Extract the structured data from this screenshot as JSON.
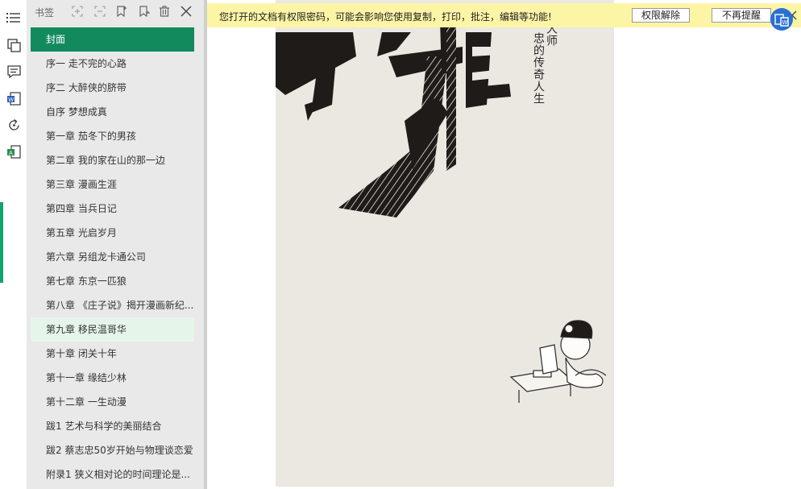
{
  "sidebar_panel": {
    "title": "书签",
    "bookmarks": [
      {
        "label": "封面"
      },
      {
        "label": "序一 走不完的心路"
      },
      {
        "label": "序二 大醉侠的脐带"
      },
      {
        "label": "自序 梦想成真"
      },
      {
        "label": "第一章 茄冬下的男孩"
      },
      {
        "label": "第二章 我的家在山的那一边"
      },
      {
        "label": "第三章 漫画生涯"
      },
      {
        "label": "第四章 当兵日记"
      },
      {
        "label": "第五章 光启岁月"
      },
      {
        "label": "第六章 另组龙卡通公司"
      },
      {
        "label": "第七章 东京一匹狼"
      },
      {
        "label": "第八章 《庄子说》揭开漫画新纪..."
      },
      {
        "label": "第九章 移民温哥华"
      },
      {
        "label": "第十章 闭关十年"
      },
      {
        "label": "第十一章 缘结少林"
      },
      {
        "label": "第十二章 一生动漫"
      },
      {
        "label": "跋1 艺术与科学的美丽结合"
      },
      {
        "label": "跋2 蔡志忠50岁开始与物理谈恋爱"
      },
      {
        "label": "附录1 狭义相对论的时间理论是..."
      }
    ],
    "active_index": 0,
    "hover_index": 12
  },
  "notice": {
    "text": "您打开的文档有权限密码，可能会影响您使用复制，打印，批注，编辑等功能!",
    "unlock_button": "权限解除",
    "dismiss_button": "不再提醒"
  },
  "cover": {
    "side_text_1": "大师",
    "side_text_2": "忠的传奇人生"
  },
  "colors": {
    "active_bookmark": "#128a5e",
    "hover_bookmark": "#e5f5ea",
    "notice_bg": "#fcf5a6",
    "panel_bg": "#e9e9e9",
    "rail_accent": "#11a36c",
    "badge": "#2a6fd6"
  },
  "icons": {
    "rail": [
      "outline-icon",
      "thumbnails-icon",
      "comments-icon",
      "pdf-to-word-icon",
      "rotate-icon",
      "translate-icon"
    ],
    "panel_header": [
      "expand-all-icon",
      "collapse-all-icon",
      "add-bookmark-icon",
      "add-child-bookmark-icon",
      "delete-bookmark-icon",
      "close-icon"
    ]
  }
}
